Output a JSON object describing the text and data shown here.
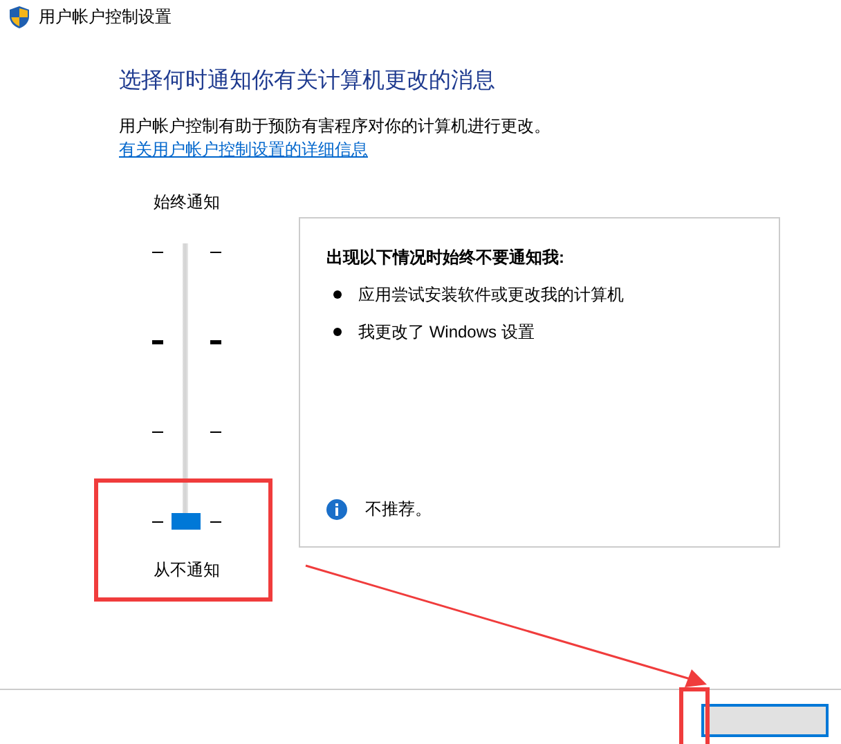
{
  "window": {
    "title": "用户帐户控制设置"
  },
  "heading": "选择何时通知你有关计算机更改的消息",
  "description": "用户帐户控制有助于预防有害程序对你的计算机进行更改。",
  "link": "有关用户帐户控制设置的详细信息",
  "slider": {
    "top_label": "始终通知",
    "bottom_label": "从不通知",
    "level": 0
  },
  "info_panel": {
    "title": "出现以下情况时始终不要通知我:",
    "items": [
      "应用尝试安装软件或更改我的计算机",
      "我更改了 Windows 设置"
    ],
    "note": "不推荐。"
  }
}
